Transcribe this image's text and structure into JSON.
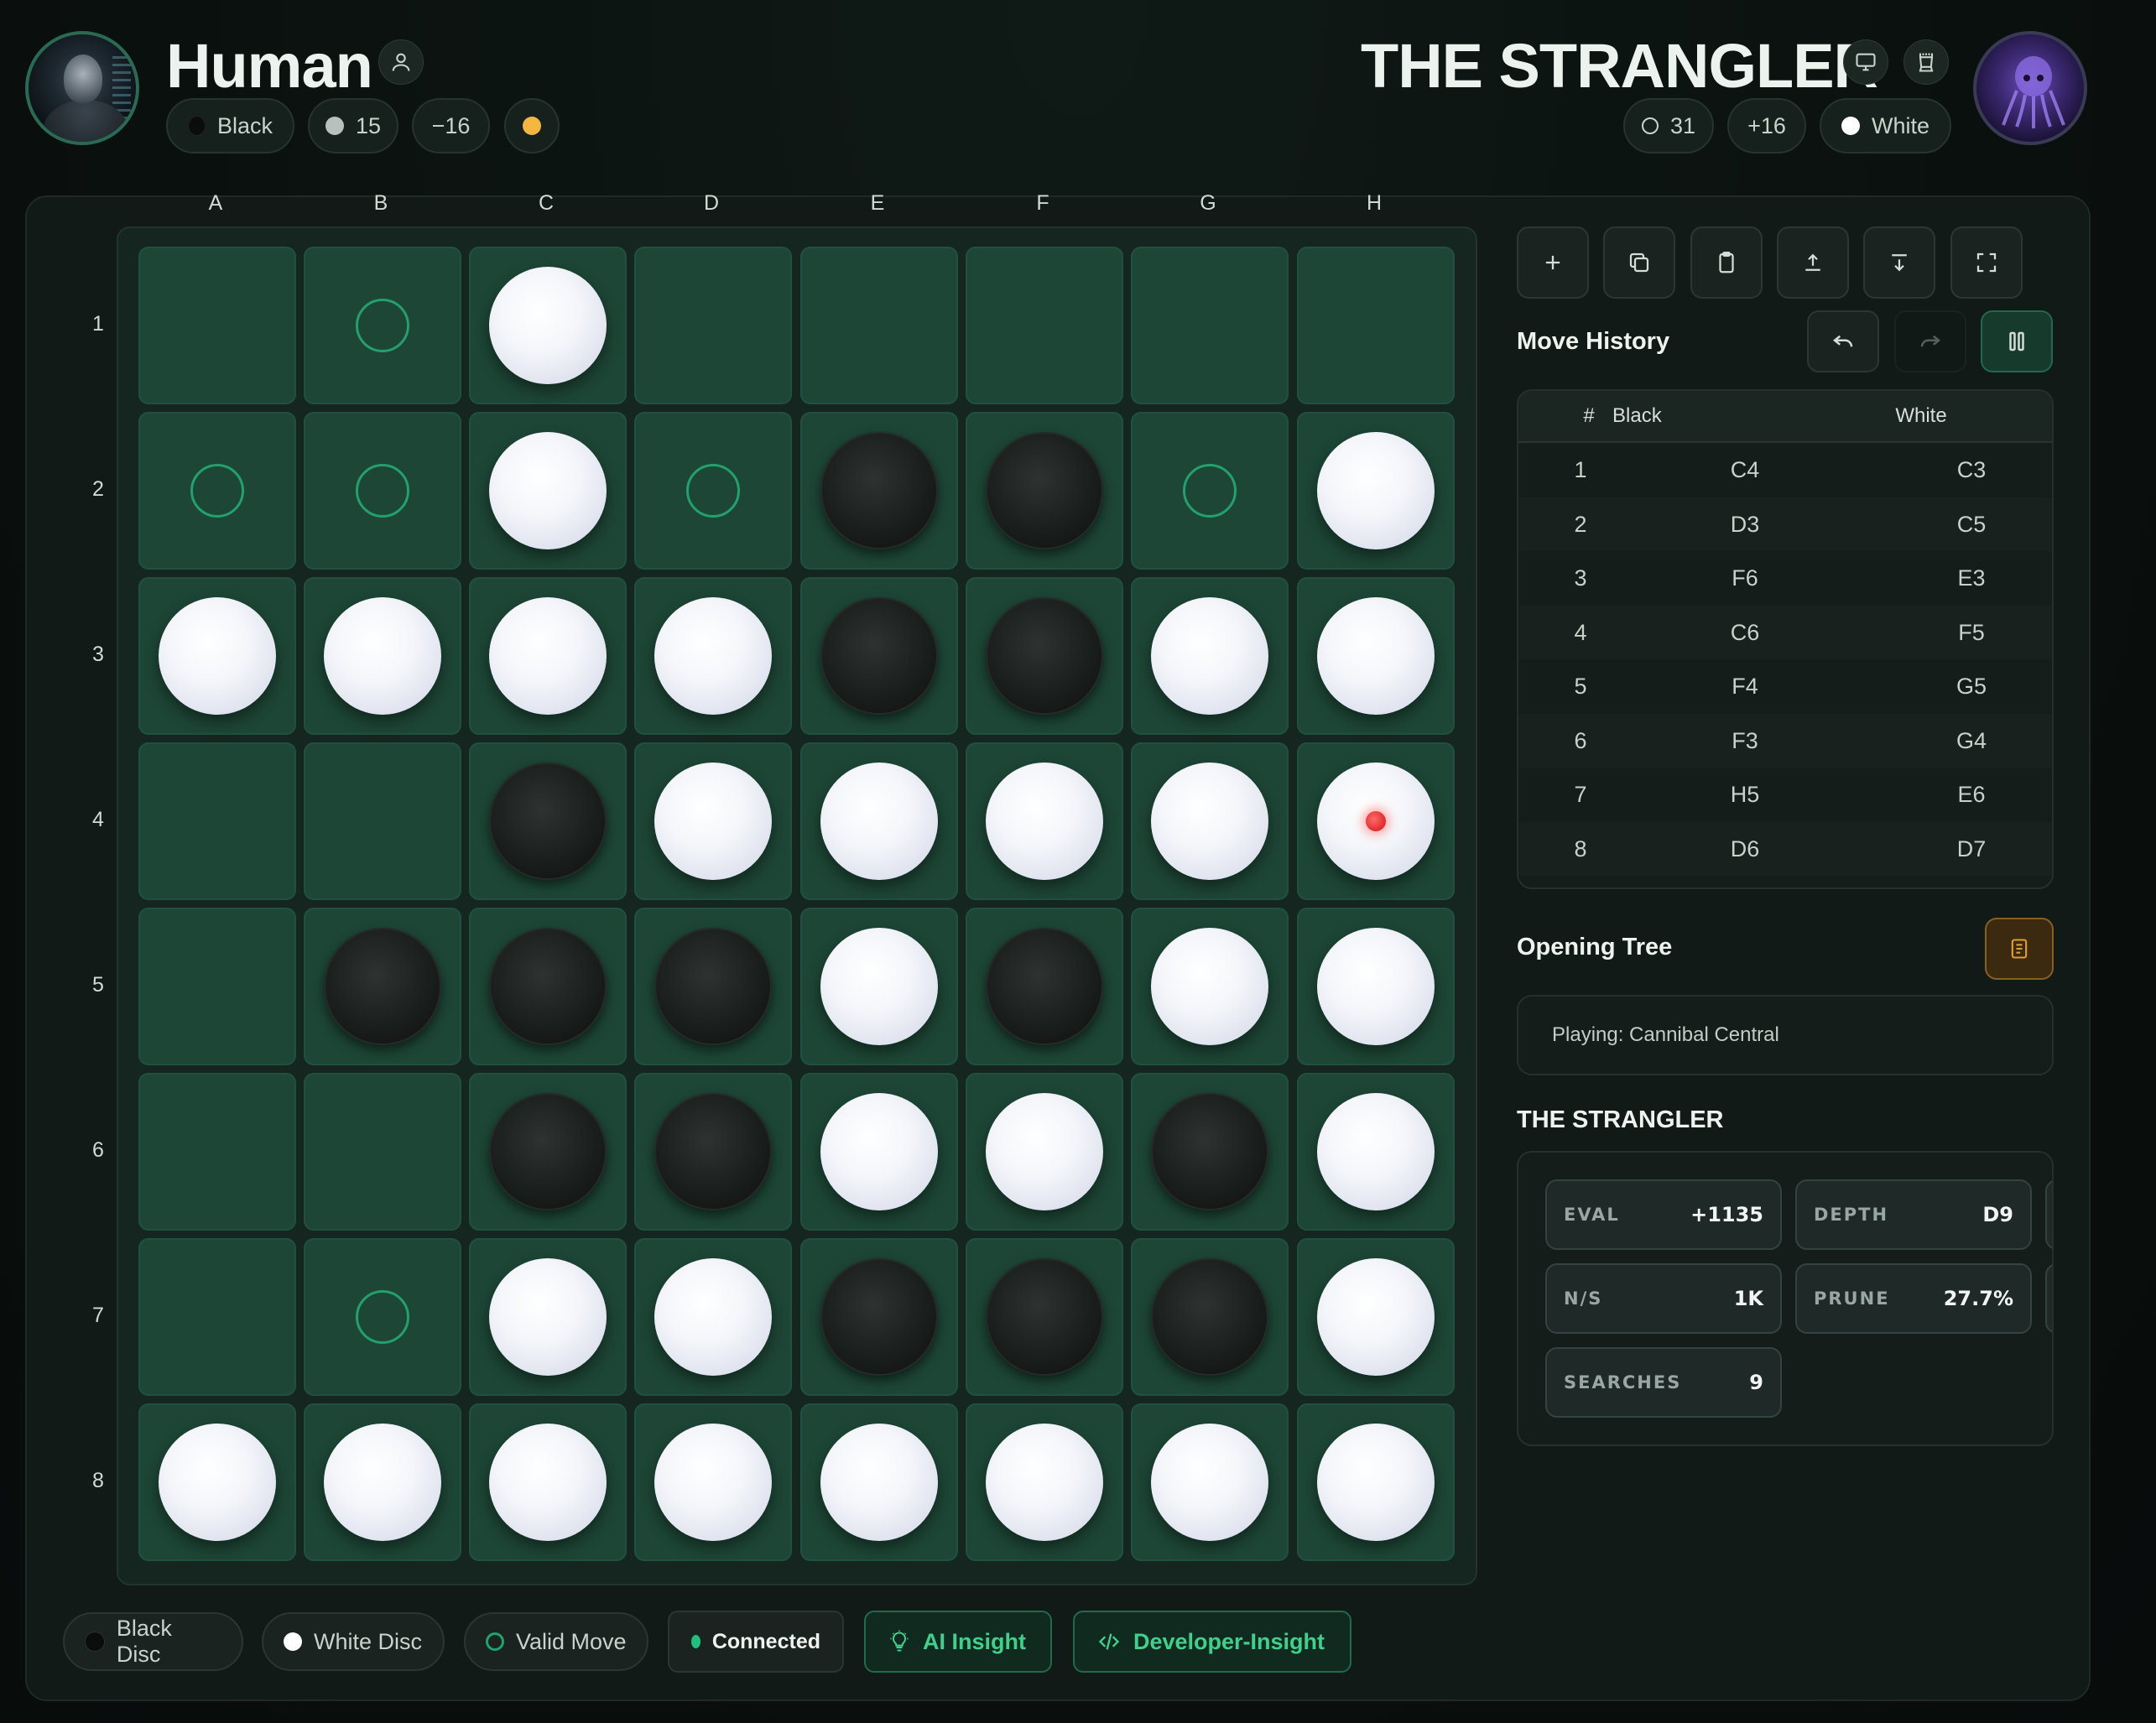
{
  "players": {
    "human": {
      "name": "Human",
      "color_label": "Black",
      "discs": "15",
      "diff": "−16"
    },
    "ai": {
      "name": "THE STRANGLER",
      "discs": "31",
      "diff": "+16",
      "color_label": "White"
    }
  },
  "board": {
    "columns": [
      "A",
      "B",
      "C",
      "D",
      "E",
      "F",
      "G",
      "H"
    ],
    "rows": [
      "1",
      "2",
      "3",
      "4",
      "5",
      "6",
      "7",
      "8"
    ],
    "cells": [
      [
        "",
        "v",
        "W",
        "",
        "",
        "",
        "",
        ""
      ],
      [
        "v",
        "v",
        "W",
        "v",
        "B",
        "B",
        "v",
        "W"
      ],
      [
        "W",
        "W",
        "W",
        "W",
        "B",
        "B",
        "W",
        "W"
      ],
      [
        "",
        "",
        "B",
        "W",
        "W",
        "W",
        "W",
        "W"
      ],
      [
        "",
        "B",
        "B",
        "B",
        "W",
        "B",
        "W",
        "W"
      ],
      [
        "",
        "",
        "B",
        "B",
        "W",
        "W",
        "B",
        "W"
      ],
      [
        "",
        "v",
        "W",
        "W",
        "B",
        "B",
        "B",
        "W"
      ],
      [
        "W",
        "W",
        "W",
        "W",
        "W",
        "W",
        "W",
        "W"
      ]
    ],
    "last_move": "H4",
    "legend": {
      "B": "black disc",
      "W": "white disc",
      "v": "valid move"
    }
  },
  "toolbar": [
    "plus-icon",
    "copy-icon",
    "clipboard-icon",
    "upload-icon",
    "download-icon",
    "fullscreen-icon"
  ],
  "history": {
    "title": "Move History",
    "headers": {
      "num": "#",
      "black": "Black",
      "white": "White"
    },
    "moves": [
      {
        "n": "1",
        "black": "C4",
        "white": "C3"
      },
      {
        "n": "2",
        "black": "D3",
        "white": "C5"
      },
      {
        "n": "3",
        "black": "F6",
        "white": "E3"
      },
      {
        "n": "4",
        "black": "C6",
        "white": "F5"
      },
      {
        "n": "5",
        "black": "F4",
        "white": "G5"
      },
      {
        "n": "6",
        "black": "F3",
        "white": "G4"
      },
      {
        "n": "7",
        "black": "H5",
        "white": "E6"
      },
      {
        "n": "8",
        "black": "D6",
        "white": "D7"
      }
    ]
  },
  "opening": {
    "title": "Opening Tree",
    "text": "Playing: Cannibal Central"
  },
  "engine": {
    "title": "THE STRANGLER",
    "stats": [
      {
        "label": "EVAL",
        "value": "+1135"
      },
      {
        "label": "DEPTH",
        "value": "D9"
      },
      {
        "label": "N/S",
        "value": "1K"
      },
      {
        "label": "PRUNE",
        "value": "27.7%"
      },
      {
        "label": "SEARCHES",
        "value": "9"
      }
    ]
  },
  "footer": {
    "black_disc": "Black Disc",
    "white_disc": "White Disc",
    "valid_move": "Valid Move",
    "connected": "Connected",
    "ai_insight": "AI Insight",
    "developer_insight": "Developer-Insight"
  },
  "colors": {
    "accent": "#22a06e",
    "board": "#1d4636",
    "turn": "#f4b63f",
    "opening_btn": "#e0a030"
  }
}
